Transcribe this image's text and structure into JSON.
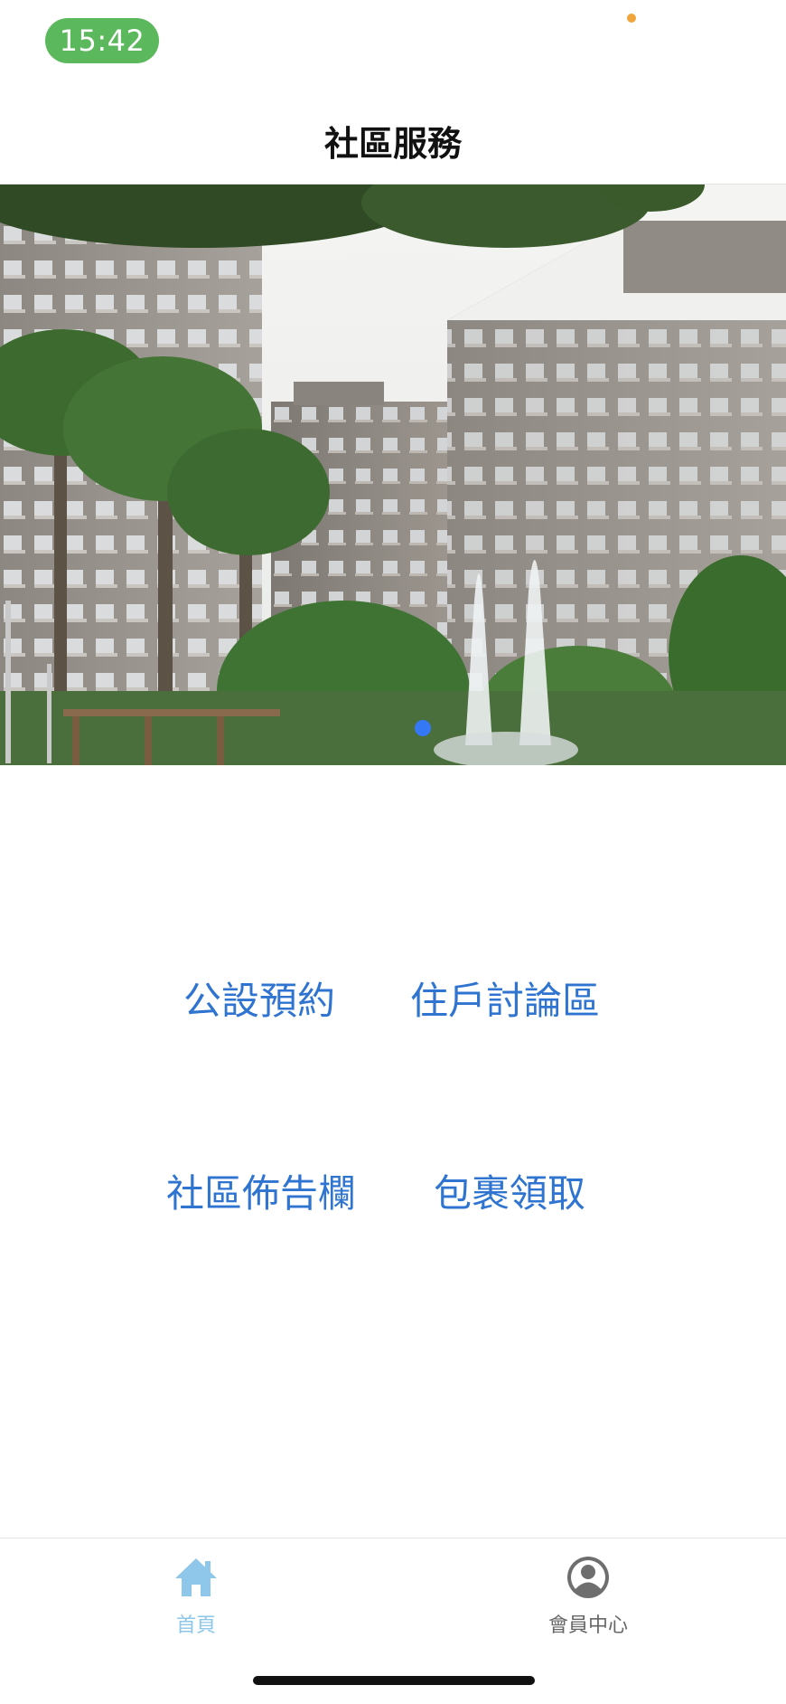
{
  "status_bar": {
    "time": "15:42"
  },
  "header": {
    "title": "社區服務"
  },
  "banner": {
    "image": "community-buildings-fountain-photo",
    "page_count": 1,
    "active_page": 1
  },
  "menu": {
    "items": [
      {
        "label": "公設預約",
        "icon": "none"
      },
      {
        "label": "住戶討論區",
        "icon": "none"
      },
      {
        "label": "社區佈告欄",
        "icon": "none"
      },
      {
        "label": "包裹領取",
        "icon": "none"
      }
    ]
  },
  "tab_bar": {
    "items": [
      {
        "label": "首頁",
        "icon": "home-icon",
        "active": true
      },
      {
        "label": "會員中心",
        "icon": "user-circle-icon",
        "active": false
      }
    ]
  },
  "colors": {
    "time_pill": "#5cb85c",
    "link": "#2f74d0",
    "active_tab": "#8ec7ea",
    "inactive_tab": "#666666",
    "page_dot": "#3478f6"
  }
}
